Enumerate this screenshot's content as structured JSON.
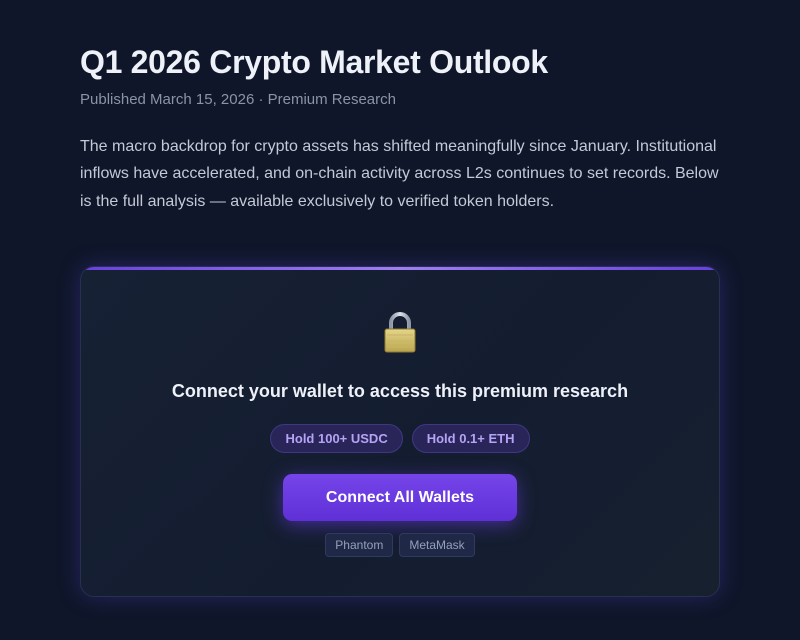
{
  "article": {
    "title": "Q1 2026 Crypto Market Outlook",
    "meta": "Published March 15, 2026 · Premium Research",
    "intro": "The macro backdrop for crypto assets has shifted meaningfully since January. Institutional inflows have accelerated, and on-chain activity across L2s continues to set records. Below is the full analysis — available exclusively to verified token holders."
  },
  "gate": {
    "icon": "lock-icon",
    "heading": "Connect your wallet to access this premium research",
    "requirements": [
      "Hold 100+ USDC",
      "Hold 0.1+ ETH"
    ],
    "connect_label": "Connect All Wallets",
    "wallets": [
      "Phantom",
      "MetaMask"
    ]
  },
  "colors": {
    "background": "#0f1629",
    "accent": "#6a3fe0",
    "badge_text": "#b4a4f5"
  }
}
